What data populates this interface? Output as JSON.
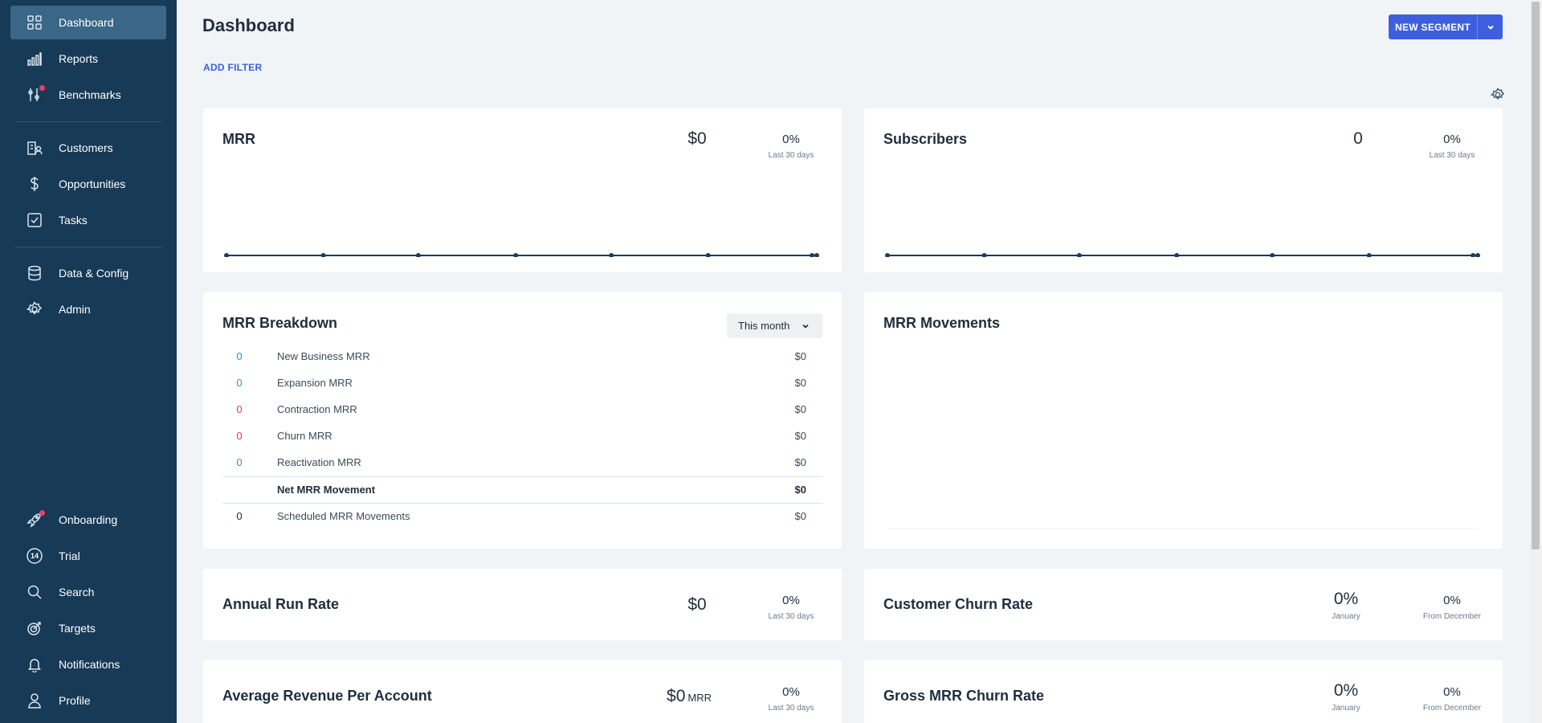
{
  "sidebar": {
    "items": [
      {
        "label": "Dashboard",
        "icon": "dashboard-icon"
      },
      {
        "label": "Reports",
        "icon": "reports-icon"
      },
      {
        "label": "Benchmarks",
        "icon": "benchmarks-icon"
      },
      {
        "label": "Customers",
        "icon": "customers-icon"
      },
      {
        "label": "Opportunities",
        "icon": "dollar-icon"
      },
      {
        "label": "Tasks",
        "icon": "checkbox-icon"
      },
      {
        "label": "Data & Config",
        "icon": "database-icon"
      },
      {
        "label": "Admin",
        "icon": "gear-icon"
      }
    ],
    "bottom_items": [
      {
        "label": "Onboarding",
        "icon": "rocket-icon"
      },
      {
        "label": "Trial",
        "icon": "trial-badge-icon",
        "badge": "14"
      },
      {
        "label": "Search",
        "icon": "search-icon"
      },
      {
        "label": "Targets",
        "icon": "target-icon"
      },
      {
        "label": "Notifications",
        "icon": "bell-icon"
      },
      {
        "label": "Profile",
        "icon": "user-icon"
      }
    ]
  },
  "header": {
    "title": "Dashboard",
    "add_filter": "ADD FILTER",
    "new_segment": "NEW SEGMENT"
  },
  "cards": {
    "mrr": {
      "title": "MRR",
      "value": "$0",
      "change": "0%",
      "caption": "Last 30 days"
    },
    "subscribers": {
      "title": "Subscribers",
      "value": "0",
      "change": "0%",
      "caption": "Last 30 days"
    },
    "breakdown": {
      "title": "MRR Breakdown",
      "period": "This month",
      "rows": [
        {
          "count": "0",
          "name": "New Business MRR",
          "amount": "$0"
        },
        {
          "count": "0",
          "name": "Expansion MRR",
          "amount": "$0"
        },
        {
          "count": "0",
          "name": "Contraction MRR",
          "amount": "$0"
        },
        {
          "count": "0",
          "name": "Churn MRR",
          "amount": "$0"
        },
        {
          "count": "0",
          "name": "Reactivation MRR",
          "amount": "$0"
        }
      ],
      "net": {
        "name": "Net MRR Movement",
        "amount": "$0"
      },
      "scheduled": {
        "count": "0",
        "name": "Scheduled MRR Movements",
        "amount": "$0"
      }
    },
    "movements": {
      "title": "MRR Movements"
    },
    "arr": {
      "title": "Annual Run Rate",
      "value": "$0",
      "change": "0%",
      "caption": "Last 30 days"
    },
    "churn": {
      "title": "Customer Churn Rate",
      "value": "0%",
      "value_caption": "January",
      "change": "0%",
      "change_caption": "From December"
    },
    "arpa": {
      "title": "Average Revenue Per Account",
      "value": "$0",
      "value_suffix": "MRR",
      "change": "0%",
      "caption": "Last 30 days"
    },
    "gross_churn": {
      "title": "Gross MRR Churn Rate",
      "value": "0%",
      "value_caption": "January",
      "change": "0%",
      "change_caption": "From December"
    }
  },
  "chart_data": [
    {
      "type": "line",
      "title": "MRR",
      "values": [
        0,
        0,
        0,
        0,
        0,
        0,
        0,
        0
      ]
    },
    {
      "type": "line",
      "title": "Subscribers",
      "values": [
        0,
        0,
        0,
        0,
        0,
        0,
        0,
        0
      ]
    }
  ],
  "colors": {
    "sidebar": "#173a56",
    "active": "#3a6687",
    "accent": "#3d5ede",
    "positive": "#2f8fd6",
    "negative": "#e8354f"
  }
}
